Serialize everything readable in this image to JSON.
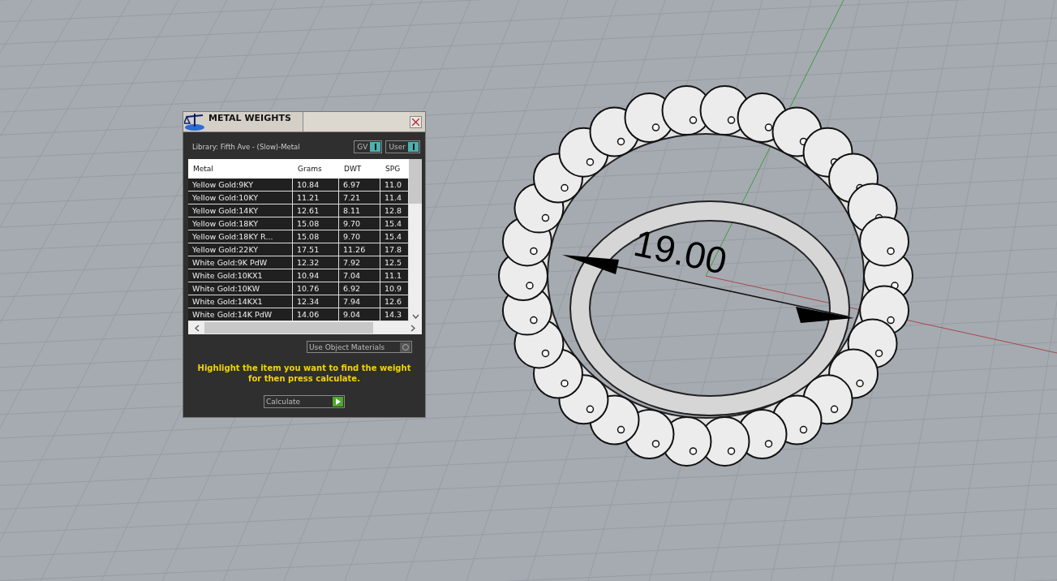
{
  "viewport": {
    "dimension_text": "19.00"
  },
  "panel": {
    "title": "METAL WEIGHTS",
    "library": "Library: Fifth Ave - (Slow)-Metal",
    "toggles": [
      {
        "label": "GV",
        "on": true
      },
      {
        "label": "User",
        "on": true
      }
    ],
    "table": {
      "columns": [
        "Metal",
        "Grams",
        "DWT",
        "SPG"
      ],
      "rows": [
        [
          "Yellow Gold:9KY",
          "10.84",
          "6.97",
          "11.0"
        ],
        [
          "Yellow Gold:10KY",
          "11.21",
          "7.21",
          "11.4"
        ],
        [
          "Yellow Gold:14KY",
          "12.61",
          "8.11",
          "12.8"
        ],
        [
          "Yellow Gold:18KY",
          "15.08",
          "9.70",
          "15.4"
        ],
        [
          "Yellow Gold:18KY R...",
          "15.08",
          "9.70",
          "15.4"
        ],
        [
          "Yellow Gold:22KY",
          "17.51",
          "11.26",
          "17.8"
        ],
        [
          "White Gold:9K PdW",
          "12.32",
          "7.92",
          "12.5"
        ],
        [
          "White Gold:10KX1",
          "10.94",
          "7.04",
          "11.1"
        ],
        [
          "White Gold:10KW",
          "10.76",
          "6.92",
          "10.9"
        ],
        [
          "White Gold:14KX1",
          "12.34",
          "7.94",
          "12.6"
        ],
        [
          "White Gold:14K PdW",
          "14.06",
          "9.04",
          "14.3"
        ]
      ]
    },
    "use_object_materials": {
      "label": "Use Object Materials",
      "on": false
    },
    "hint": "Highlight the item you want to find the weight for then press calculate.",
    "calculate_button": "Calculate"
  }
}
